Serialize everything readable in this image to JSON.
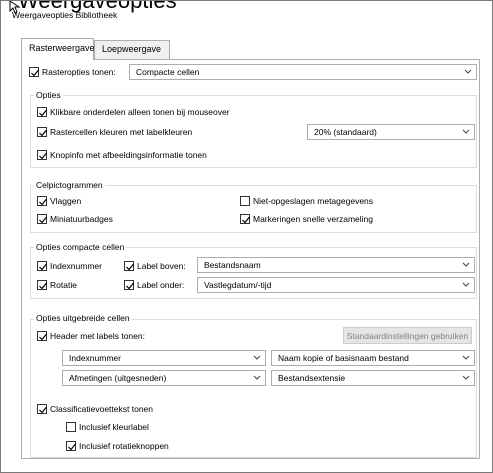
{
  "overlay_text": "Weergaveopties",
  "window": {
    "title": "Weergaveopties Bibliotheek"
  },
  "tabs": [
    {
      "label": "Rasterweergave",
      "active": true
    },
    {
      "label": "Loepweergave",
      "active": false
    }
  ],
  "raster_options": {
    "label": "Rasteropties tonen:",
    "checked": true,
    "value": "Compacte cellen"
  },
  "opties": {
    "title": "Opties",
    "items": [
      {
        "label": "Klikbare onderdelen alleen tonen bij mouseover",
        "checked": true
      },
      {
        "label": "Rastercellen kleuren met labelkleuren",
        "checked": true
      },
      {
        "label": "Knopinfo met afbeeldingsinformatie tonen",
        "checked": true
      }
    ],
    "tint_value": "20% (standaard)"
  },
  "celpictogrammen": {
    "title": "Celpictogrammen",
    "items": [
      {
        "label": "Vlaggen",
        "checked": true
      },
      {
        "label": "Niet-opgeslagen metagegevens",
        "checked": false
      },
      {
        "label": "Miniatuurbadges",
        "checked": true
      },
      {
        "label": "Markeringen snelle verzameling",
        "checked": true
      }
    ]
  },
  "compact": {
    "title": "Opties compacte cellen",
    "index_label": "Indexnummer",
    "index_checked": true,
    "rotation_label": "Rotatie",
    "rotation_checked": true,
    "top_label": "Label boven:",
    "top_checked": true,
    "top_value": "Bestandsnaam",
    "bottom_label": "Label onder:",
    "bottom_checked": true,
    "bottom_value": "Vastlegdatum/-tijd"
  },
  "extended": {
    "title": "Opties uitgebreide cellen",
    "header_label": "Header met labels tonen:",
    "header_checked": true,
    "defaults_button": "Standaardinstellingen gebruiken",
    "fields": [
      "Indexnummer",
      "Naam kopie of basisnaam bestand",
      "Afmetingen (uitgesneden)",
      "Bestandsextensie"
    ],
    "footer_label": "Classificatievoettekst tonen",
    "footer_checked": true,
    "color_label": "Inclusief kleurlabel",
    "color_checked": false,
    "rotate_label": "Inclusief rotatieknoppen",
    "rotate_checked": true
  }
}
